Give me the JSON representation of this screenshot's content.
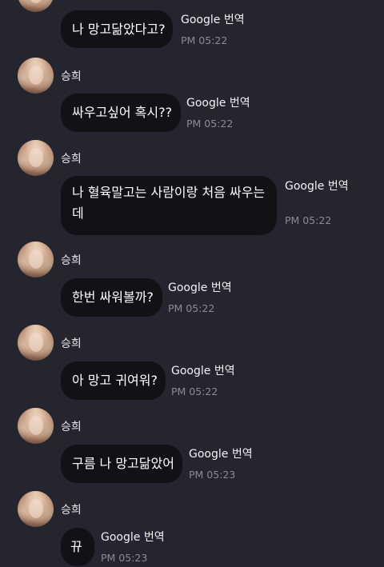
{
  "messages": [
    {
      "sender": "",
      "text": "나 망고닮았다고?",
      "translate_label": "Google 번역",
      "time": "PM 05:22"
    },
    {
      "sender": "승희",
      "text": "싸우고싶어 혹시??",
      "translate_label": "Google 번역",
      "time": "PM 05:22"
    },
    {
      "sender": "승희",
      "text": "나 혈육말고는 사람이랑 처음 싸우는데",
      "translate_label": "Google 번역",
      "time": "PM 05:22"
    },
    {
      "sender": "승희",
      "text": "한번 싸워볼까?",
      "translate_label": "Google 번역",
      "time": "PM 05:22"
    },
    {
      "sender": "승희",
      "text": "아 망고 귀여워?",
      "translate_label": "Google 번역",
      "time": "PM 05:22"
    },
    {
      "sender": "승희",
      "text": "구름 나 망고닮았어",
      "translate_label": "Google 번역",
      "time": "PM 05:23"
    },
    {
      "sender": "승희",
      "text": "뀨",
      "translate_label": "Google 번역",
      "time": "PM 05:23"
    }
  ],
  "colors": {
    "background": "#252530",
    "bubble": "#121216",
    "text": "#ffffff",
    "time": "#8b8b96"
  }
}
